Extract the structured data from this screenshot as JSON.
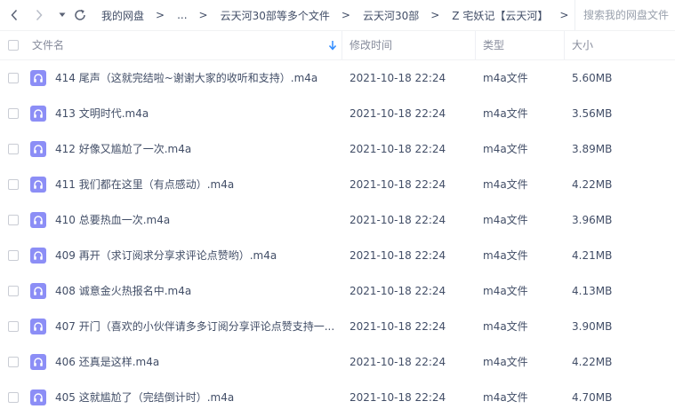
{
  "nav": {
    "breadcrumbs": [
      "我的网盘",
      "...",
      "云天河30部等多个文件",
      "云天河30部",
      "Z 宅妖记【云天河】"
    ],
    "search_placeholder": "搜索我的网盘文件"
  },
  "table": {
    "columns": {
      "name": "文件名",
      "modified": "修改时间",
      "type": "类型",
      "size": "大小"
    },
    "sort": "name-descending",
    "rows": [
      {
        "name": "414 尾声（这就完结啦~谢谢大家的收听和支持）.m4a",
        "modified": "2021-10-18 22:24",
        "type": "m4a文件",
        "size": "5.60MB"
      },
      {
        "name": "413 文明时代.m4a",
        "modified": "2021-10-18 22:24",
        "type": "m4a文件",
        "size": "3.56MB"
      },
      {
        "name": "412 好像又尴尬了一次.m4a",
        "modified": "2021-10-18 22:24",
        "type": "m4a文件",
        "size": "3.89MB"
      },
      {
        "name": "411 我们都在这里（有点感动）.m4a",
        "modified": "2021-10-18 22:24",
        "type": "m4a文件",
        "size": "4.22MB"
      },
      {
        "name": "410 总要热血一次.m4a",
        "modified": "2021-10-18 22:24",
        "type": "m4a文件",
        "size": "3.96MB"
      },
      {
        "name": "409 再开（求订阅求分享求评论点赞哟）.m4a",
        "modified": "2021-10-18 22:24",
        "type": "m4a文件",
        "size": "4.21MB"
      },
      {
        "name": "408 诚意金火热报名中.m4a",
        "modified": "2021-10-18 22:24",
        "type": "m4a文件",
        "size": "4.13MB"
      },
      {
        "name": "407 开门（喜欢的小伙伴请多多订阅分享评论点赞支持一...",
        "modified": "2021-10-18 22:24",
        "type": "m4a文件",
        "size": "3.90MB"
      },
      {
        "name": "406 还真是这样.m4a",
        "modified": "2021-10-18 22:24",
        "type": "m4a文件",
        "size": "4.22MB"
      },
      {
        "name": "405 这就尴尬了（完结倒计时）.m4a",
        "modified": "2021-10-18 22:24",
        "type": "m4a文件",
        "size": "4.70MB"
      }
    ]
  },
  "icons": {
    "back": "chevron-left-icon",
    "forward": "chevron-right-icon",
    "history": "caret-down-icon",
    "refresh": "refresh-icon",
    "file": "audio-file-icon"
  },
  "colors": {
    "text": "#424e67",
    "header_text": "#878c9c",
    "accent": "#2f8bff",
    "file_icon": "#8c8ef6"
  }
}
